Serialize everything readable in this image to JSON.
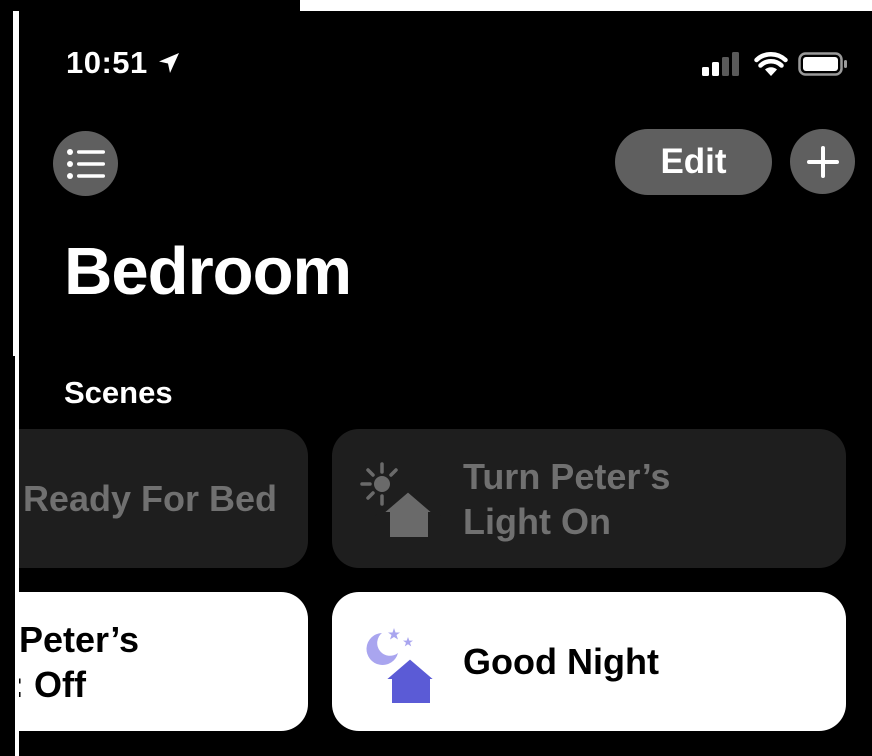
{
  "status_bar": {
    "time": "10:51"
  },
  "toolbar": {
    "edit_label": "Edit",
    "add_label": "+"
  },
  "page": {
    "title": "Bedroom",
    "section": "Scenes"
  },
  "scenes": [
    {
      "line1": "Ready For Bed",
      "line2": "",
      "active": false
    },
    {
      "line1": "Turn Peter’s",
      "line2": "Light On",
      "active": false
    },
    {
      "line1": "Peter’s",
      "line2": ": Off",
      "active": true
    },
    {
      "line1": "Good Night",
      "line2": "",
      "active": true
    }
  ],
  "colors": {
    "background": "#000000",
    "button_gray": "#5f5f5f",
    "tile_inactive": "#1e1e1e",
    "tile_active": "#ffffff",
    "good_night_icon": "#5b5bd6"
  }
}
